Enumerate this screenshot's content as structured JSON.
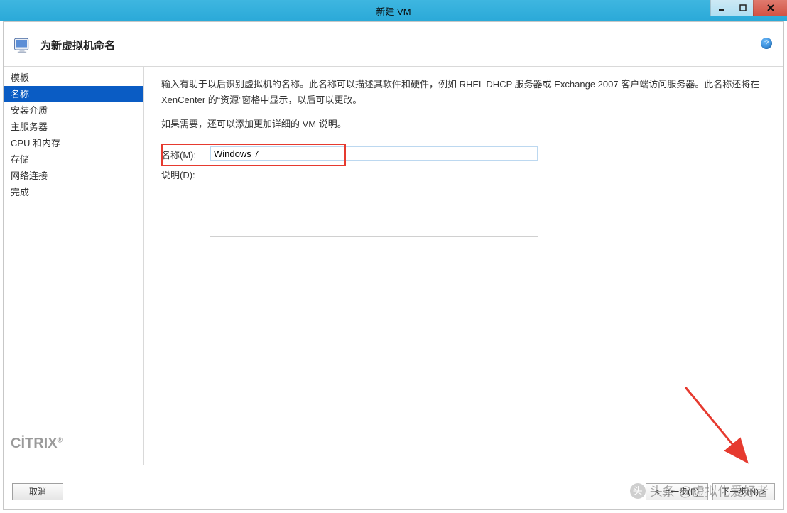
{
  "window": {
    "title": "新建 VM"
  },
  "header": {
    "title": "为新虚拟机命名"
  },
  "sidebar": {
    "items": [
      {
        "label": "模板",
        "selected": false
      },
      {
        "label": "名称",
        "selected": true
      },
      {
        "label": "安装介质",
        "selected": false
      },
      {
        "label": "主服务器",
        "selected": false
      },
      {
        "label": "CPU 和内存",
        "selected": false
      },
      {
        "label": "存储",
        "selected": false
      },
      {
        "label": "网络连接",
        "selected": false
      },
      {
        "label": "完成",
        "selected": false
      }
    ],
    "logo": "CİTRIX"
  },
  "content": {
    "instruction_line1": "输入有助于以后识别虚拟机的名称。此名称可以描述其软件和硬件，例如 RHEL DHCP 服务器或 Exchange 2007 客户端访问服务器。此名称还将在 XenCenter 的“资源”窗格中显示，以后可以更改。",
    "instruction_line2": "如果需要，还可以添加更加详细的 VM 说明。",
    "name_label": "名称(M):",
    "name_value": "Windows 7",
    "desc_label": "说明(D):",
    "desc_value": ""
  },
  "footer": {
    "cancel": "取消",
    "prev": "< 上一步(P)",
    "next": "下一步(N) >"
  },
  "watermark": {
    "text": "头条 @虚拟化爱好者"
  }
}
